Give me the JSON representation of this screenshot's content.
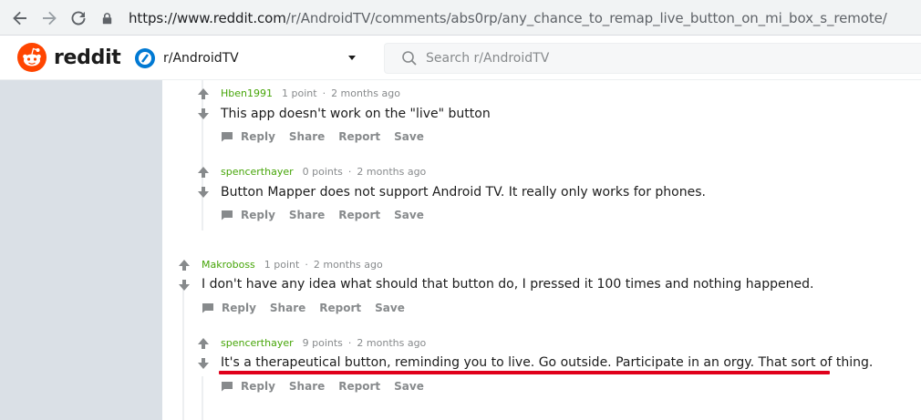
{
  "browser": {
    "url_prefix": "https://www.reddit.com",
    "url_path": "/r/AndroidTV/comments/abs0rp/any_chance_to_remap_live_button_on_mi_box_s_remote/"
  },
  "header": {
    "logo_text": "reddit",
    "subreddit": "r/AndroidTV",
    "search_placeholder": "Search r/AndroidTV"
  },
  "comments": [
    {
      "author": "Hben1991",
      "points": "1 point",
      "sep": "·",
      "time": "2 months ago",
      "text": "This app doesn't work on the \"live\" button",
      "actions": [
        "Reply",
        "Share",
        "Report",
        "Save"
      ]
    },
    {
      "author": "spencerthayer",
      "points": "0 points",
      "sep": "·",
      "time": "2 months ago",
      "text": "Button Mapper does not support Android TV. It really only works for phones.",
      "actions": [
        "Reply",
        "Share",
        "Report",
        "Save"
      ]
    },
    {
      "author": "Makroboss",
      "points": "1 point",
      "sep": "·",
      "time": "2 months ago",
      "text": "I don't have any idea what should that button do, I pressed it 100 times and nothing happened.",
      "actions": [
        "Reply",
        "Share",
        "Report",
        "Save"
      ]
    },
    {
      "author": "spencerthayer",
      "points": "9 points",
      "sep": "·",
      "time": "2 months ago",
      "text": "It's a therapeutical button, reminding you to live. Go outside. Participate in an orgy. That sort of thing.",
      "actions": [
        "Reply",
        "Share",
        "Report",
        "Save"
      ]
    }
  ],
  "colors": {
    "author": "#46a508",
    "highlight": "#e0001b",
    "brand": "#ff4500"
  }
}
